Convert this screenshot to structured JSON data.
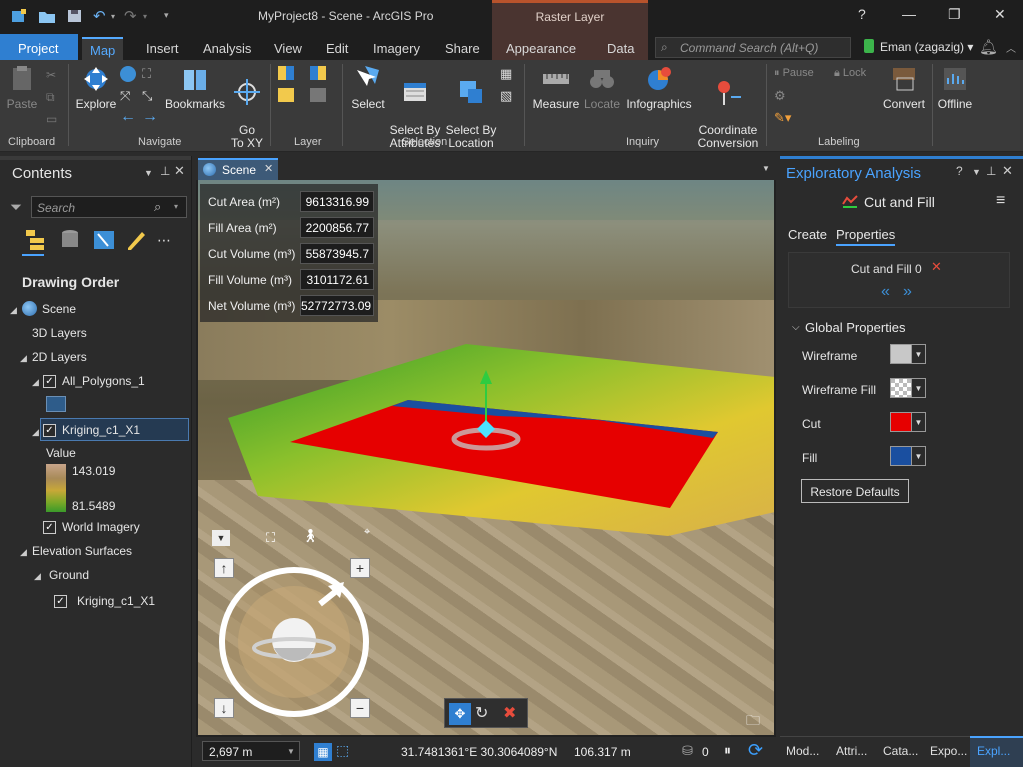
{
  "title_bar": {
    "project_title": "MyProject8 - Scene - ArcGIS Pro",
    "context_tab": "Raster Layer",
    "help": "?",
    "minimize": "—",
    "restore": "❐",
    "close": "✕"
  },
  "ribbon_tabs": [
    "Project",
    "Map",
    "Insert",
    "Analysis",
    "View",
    "Edit",
    "Imagery",
    "Share",
    "Appearance",
    "Data"
  ],
  "command_search": {
    "placeholder": "Command Search (Alt+Q)"
  },
  "user": "Eman (zagazig) ▾",
  "ribbon": {
    "paste": "Paste",
    "explore": "Explore",
    "bookmarks": "Bookmarks",
    "go_to_xy": "Go\nTo XY",
    "select": "Select",
    "select_by_attributes": "Select By\nAttributes",
    "select_by_location": "Select By\nLocation",
    "measure": "Measure",
    "locate": "Locate",
    "infographics": "Infographics",
    "coordinate_conversion": "Coordinate\nConversion",
    "pause": "Pause",
    "lock": "Lock",
    "convert": "Convert",
    "offline": "Offline",
    "groups": [
      "Clipboard",
      "Navigate",
      "Layer",
      "Selection",
      "Inquiry",
      "Labeling"
    ]
  },
  "contents": {
    "title": "Contents",
    "search_placeholder": "Search",
    "drawing_order": "Drawing Order",
    "items": {
      "scene": "Scene",
      "layers_3d": "3D Layers",
      "layers_2d": "2D Layers",
      "all_polygons": "All_Polygons_1",
      "kriging": "Kriging_c1_X1",
      "value": "Value",
      "max": "143.019",
      "min": "81.5489",
      "world_imagery": "World Imagery",
      "elevation": "Elevation Surfaces",
      "ground": "Ground",
      "ground_kriging": "Kriging_c1_X1"
    }
  },
  "scene": {
    "tab": "Scene",
    "measurements": [
      {
        "label": "Cut Area (m²)",
        "value": "9613316.99"
      },
      {
        "label": "Fill Area (m²)",
        "value": "2200856.77"
      },
      {
        "label": "Cut Volume (m³)",
        "value": "55873945.7"
      },
      {
        "label": "Fill Volume (m³)",
        "value": "3101172.61"
      },
      {
        "label": "Net Volume (m³)",
        "value": "52772773.09"
      }
    ],
    "scale": "2,697 m",
    "coordinates": "31.7481361°E 30.3064089°N",
    "elevation": "106.317 m",
    "selected_count": "0"
  },
  "explore": {
    "title": "Exploratory Analysis",
    "tool": "Cut and Fill",
    "tabs": [
      "Create",
      "Properties"
    ],
    "item": "Cut and Fill 0",
    "global_properties": "Global Properties",
    "props": [
      {
        "label": "Wireframe",
        "color": "#c8c8c8"
      },
      {
        "label": "Wireframe Fill",
        "color": "checker"
      },
      {
        "label": "Cut",
        "color": "#e60000"
      },
      {
        "label": "Fill",
        "color": "#1a4fa0"
      }
    ],
    "restore_defaults": "Restore Defaults",
    "bottom_tabs": [
      "Mod...",
      "Attri...",
      "Cata...",
      "Expo...",
      "Expl..."
    ]
  },
  "colors": {
    "accent": "#2f7fd1",
    "cut": "#e60000",
    "fill": "#1a4fa0"
  }
}
